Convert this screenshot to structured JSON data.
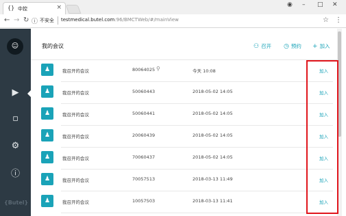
{
  "browser": {
    "tab_title": "中控",
    "tab_favicon": "{}",
    "url_security": "不安全",
    "url_host": "testmedical.butel.com",
    "url_path": ":96/BMCTWeb/#/mainView"
  },
  "sidebar": {
    "logo_text": "{Butel}"
  },
  "header": {
    "title": "我的会议",
    "start_label": "召开",
    "book_label": "预约",
    "join_label": "加入"
  },
  "meetings": [
    {
      "name": "我召开的会议",
      "number": "80064025",
      "locked": true,
      "time": "今天 10:08",
      "action": "加入"
    },
    {
      "name": "我召开的会议",
      "number": "50060443",
      "locked": false,
      "time": "2018-05-02 14:05",
      "action": "加入"
    },
    {
      "name": "我召开的会议",
      "number": "50060441",
      "locked": false,
      "time": "2018-05-02 14:05",
      "action": "加入"
    },
    {
      "name": "我召开的会议",
      "number": "20060439",
      "locked": false,
      "time": "2018-05-02 14:05",
      "action": "加入"
    },
    {
      "name": "我召开的会议",
      "number": "70060437",
      "locked": false,
      "time": "2018-05-02 14:05",
      "action": "加入"
    },
    {
      "name": "我召开的会议",
      "number": "70057513",
      "locked": false,
      "time": "2018-03-13 11:49",
      "action": "加入"
    },
    {
      "name": "我召开的会议",
      "number": "10057503",
      "locked": false,
      "time": "2018-03-13 11:41",
      "action": "加入"
    }
  ],
  "colors": {
    "accent": "#1aa3b8",
    "sidebar": "#2d3a44",
    "highlight": "#e0141b"
  }
}
